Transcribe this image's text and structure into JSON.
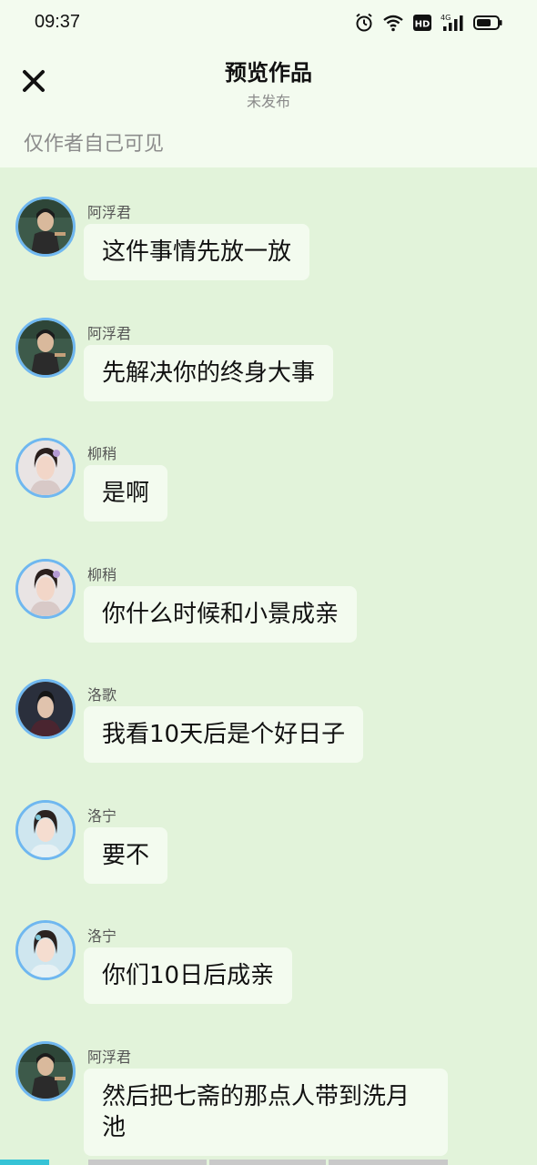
{
  "status": {
    "time": "09:37",
    "icons": [
      "alarm-icon",
      "wifi-icon",
      "hd-icon",
      "4g-signal-icon",
      "battery-icon"
    ],
    "hd_label": "HD",
    "network_label": "4G"
  },
  "header": {
    "close_icon": "close-icon",
    "title": "预览作品",
    "subtitle": "未发布",
    "visibility_note": "仅作者自己可见"
  },
  "messages": [
    {
      "sender": "阿浮君",
      "text": "这件事情先放一放",
      "avatar": "avatar-afujun"
    },
    {
      "sender": "阿浮君",
      "text": "先解决你的终身大事",
      "avatar": "avatar-afujun"
    },
    {
      "sender": "柳稍",
      "text": "是啊",
      "avatar": "avatar-liushao"
    },
    {
      "sender": "柳稍",
      "text": "你什么时候和小景成亲",
      "avatar": "avatar-liushao"
    },
    {
      "sender": "洛歌",
      "text": "我看10天后是个好日子",
      "avatar": "avatar-luoge"
    },
    {
      "sender": "洛宁",
      "text": "要不",
      "avatar": "avatar-luoning"
    },
    {
      "sender": "洛宁",
      "text": "你们10日后成亲",
      "avatar": "avatar-luoning"
    },
    {
      "sender": "阿浮君",
      "text": "然后把七斋的那点人带到洗月池",
      "avatar": "avatar-afujun"
    }
  ],
  "colors": {
    "background": "#e2f3da",
    "header_bg": "#f3fbef",
    "bubble_bg": "#f3fbef",
    "avatar_border": "#6fb7f0",
    "bottom_accent": "#36c3d6"
  }
}
